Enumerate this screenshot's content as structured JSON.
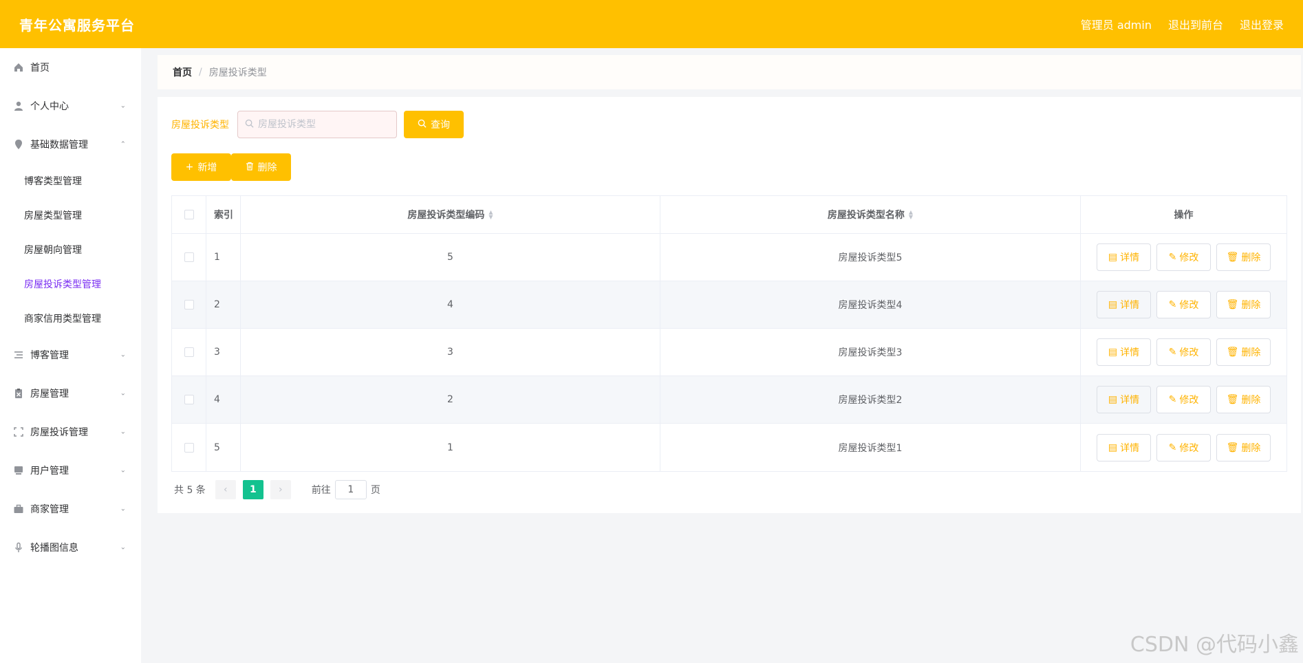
{
  "header": {
    "title": "青年公寓服务平台",
    "user_label": "管理员 admin",
    "to_front_label": "退出到前台",
    "logout_label": "退出登录",
    "bg_color": "#ffc000"
  },
  "sidebar": {
    "items": [
      {
        "label": "首页",
        "icon": "home-icon"
      },
      {
        "label": "个人中心",
        "icon": "user-icon"
      },
      {
        "label": "基础数据管理",
        "icon": "location-icon"
      },
      {
        "label": "博客管理",
        "icon": "list-icon"
      },
      {
        "label": "房屋管理",
        "icon": "clipboard-icon"
      },
      {
        "label": "房屋投诉管理",
        "icon": "fullscreen-icon"
      },
      {
        "label": "用户管理",
        "icon": "monitor-icon"
      },
      {
        "label": "商家管理",
        "icon": "briefcase-icon"
      },
      {
        "label": "轮播图信息",
        "icon": "microphone-icon"
      }
    ],
    "submenu": [
      {
        "label": "博客类型管理"
      },
      {
        "label": "房屋类型管理"
      },
      {
        "label": "房屋朝向管理"
      },
      {
        "label": "房屋投诉类型管理"
      },
      {
        "label": "商家信用类型管理"
      }
    ]
  },
  "breadcrumb": {
    "home": "首页",
    "separator": "/",
    "current": "房屋投诉类型"
  },
  "search": {
    "label": "房屋投诉类型",
    "placeholder": "房屋投诉类型",
    "button_label": "查询"
  },
  "actions": {
    "add_label": "新增",
    "delete_label": "删除"
  },
  "table": {
    "headers": {
      "index": "索引",
      "code": "房屋投诉类型编码",
      "name": "房屋投诉类型名称",
      "ops": "操作"
    },
    "rows": [
      {
        "index": "1",
        "code": "5",
        "name": "房屋投诉类型5"
      },
      {
        "index": "2",
        "code": "4",
        "name": "房屋投诉类型4"
      },
      {
        "index": "3",
        "code": "3",
        "name": "房屋投诉类型3"
      },
      {
        "index": "4",
        "code": "2",
        "name": "房屋投诉类型2"
      },
      {
        "index": "5",
        "code": "1",
        "name": "房屋投诉类型1"
      }
    ],
    "ops": {
      "detail": "详情",
      "edit": "修改",
      "delete": "删除"
    }
  },
  "pagination": {
    "total": "共 5 条",
    "current_page": "1",
    "goto_label": "前往",
    "goto_value": "1",
    "page_suffix": "页"
  },
  "watermark": "CSDN @代码小鑫",
  "colors": {
    "accent": "#ffc000",
    "active_menu": "#7a2ef2",
    "page_active": "#13c28f"
  }
}
